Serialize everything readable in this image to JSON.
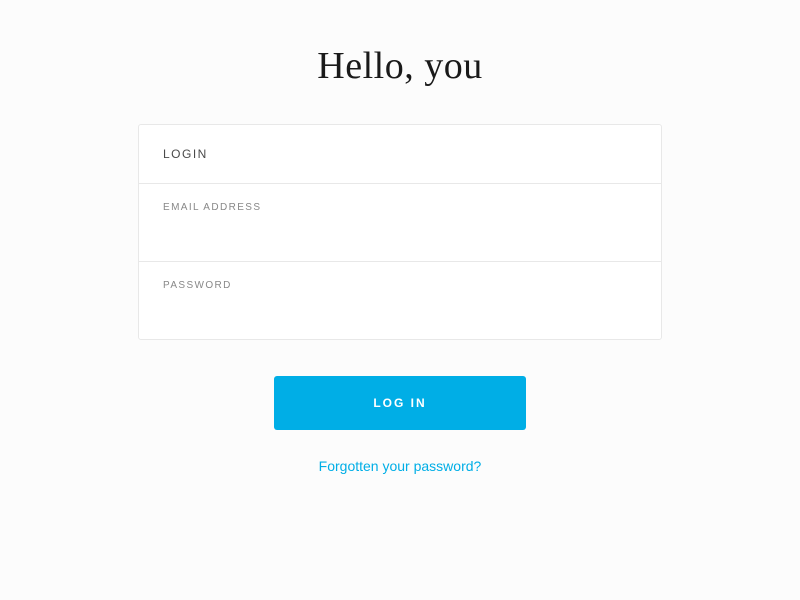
{
  "page": {
    "title": "Hello, you"
  },
  "card": {
    "header": "LOGIN"
  },
  "fields": {
    "email": {
      "label": "EMAIL ADDRESS",
      "value": ""
    },
    "password": {
      "label": "PASSWORD",
      "value": ""
    }
  },
  "actions": {
    "login_button": "LOG IN",
    "forgot_password": "Forgotten your password?"
  }
}
